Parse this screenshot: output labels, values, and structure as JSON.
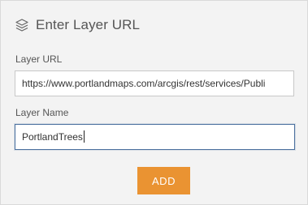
{
  "header": {
    "icon": "layers-icon",
    "title": "Enter Layer URL"
  },
  "form": {
    "url_label": "Layer URL",
    "url_value": "https://www.portlandmaps.com/arcgis/rest/services/Publi",
    "name_label": "Layer Name",
    "name_value": "PortlandTrees"
  },
  "actions": {
    "add_label": "ADD"
  },
  "colors": {
    "panel_bg": "#f3f3f3",
    "accent": "#ea9332",
    "focus_border": "#4a6f9e"
  }
}
